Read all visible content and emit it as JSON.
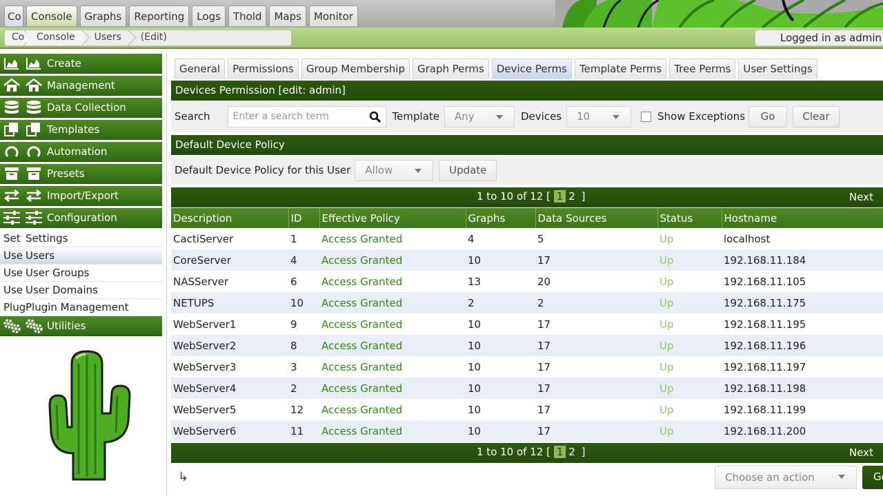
{
  "top_tabs": [
    "Co",
    "Console",
    "Graphs",
    "Reporting",
    "Logs",
    "Thold",
    "Maps",
    "Monitor"
  ],
  "breadcrumb": [
    "Co",
    "Console",
    "Users",
    "(Edit)"
  ],
  "login_text": "Logged in as admin",
  "nav": {
    "groups": [
      {
        "label": "Create",
        "icon": "chart-area-icon"
      },
      {
        "label": "Management",
        "icon": "home-icon"
      },
      {
        "label": "Data Collection",
        "icon": "database-icon"
      },
      {
        "label": "Templates",
        "icon": "copy-icon"
      },
      {
        "label": "Automation",
        "icon": "circle-notch-icon"
      },
      {
        "label": "Presets",
        "icon": "archive-icon"
      },
      {
        "label": "Import/Export",
        "icon": "exchange-icon"
      },
      {
        "label": "Configuration",
        "icon": "sliders-icon"
      }
    ],
    "items": [
      {
        "pre": "Set",
        "label": "Settings"
      },
      {
        "pre": "Use",
        "label": "Users"
      },
      {
        "pre": "Use",
        "label": "User Groups"
      },
      {
        "pre": "Use",
        "label": "User Domains"
      },
      {
        "pre": "Plug",
        "label": "Plugin Management"
      }
    ],
    "utilities": {
      "label": "Utilities",
      "icon": "gears-icon"
    }
  },
  "tabs": [
    "General",
    "Permissions",
    "Group Membership",
    "Graph Perms",
    "Device Perms",
    "Template Perms",
    "Tree Perms",
    "User Settings"
  ],
  "section_title": "Devices Permission [edit: admin]",
  "filter": {
    "search_label": "Search",
    "search_placeholder": "Enter a search term",
    "template_label": "Template",
    "template_value": "Any",
    "devices_label": "Devices",
    "devices_value": "10",
    "exceptions_label": "Show Exceptions",
    "go_label": "Go",
    "clear_label": "Clear"
  },
  "policy": {
    "header": "Default Device Policy",
    "label": "Default Device Policy for this User",
    "value": "Allow",
    "update_label": "Update"
  },
  "pager": {
    "range": "1 to 10 of 12 [",
    "pages": [
      "1",
      "2"
    ],
    "close": "]",
    "next": "Next"
  },
  "columns": [
    "Description",
    "ID",
    "Effective Policy",
    "Graphs",
    "Data Sources",
    "Status",
    "Hostname"
  ],
  "rows": [
    [
      "CactiServer",
      "1",
      "Access Granted",
      "4",
      "5",
      "Up",
      "localhost"
    ],
    [
      "CoreServer",
      "4",
      "Access Granted",
      "10",
      "17",
      "Up",
      "192.168.11.184"
    ],
    [
      "NASServer",
      "6",
      "Access Granted",
      "13",
      "20",
      "Up",
      "192.168.11.105"
    ],
    [
      "NETUPS",
      "10",
      "Access Granted",
      "2",
      "2",
      "Up",
      "192.168.11.175"
    ],
    [
      "WebServer1",
      "9",
      "Access Granted",
      "10",
      "17",
      "Up",
      "192.168.11.195"
    ],
    [
      "WebServer2",
      "8",
      "Access Granted",
      "10",
      "17",
      "Up",
      "192.168.11.196"
    ],
    [
      "WebServer3",
      "3",
      "Access Granted",
      "10",
      "17",
      "Up",
      "192.168.11.197"
    ],
    [
      "WebServer4",
      "2",
      "Access Granted",
      "10",
      "17",
      "Up",
      "192.168.11.198"
    ],
    [
      "WebServer5",
      "12",
      "Access Granted",
      "10",
      "17",
      "Up",
      "192.168.11.199"
    ],
    [
      "WebServer6",
      "11",
      "Access Granted",
      "10",
      "17",
      "Up",
      "192.168.11.200"
    ]
  ],
  "actions": {
    "placeholder": "Choose an action",
    "go_label": "Go"
  }
}
